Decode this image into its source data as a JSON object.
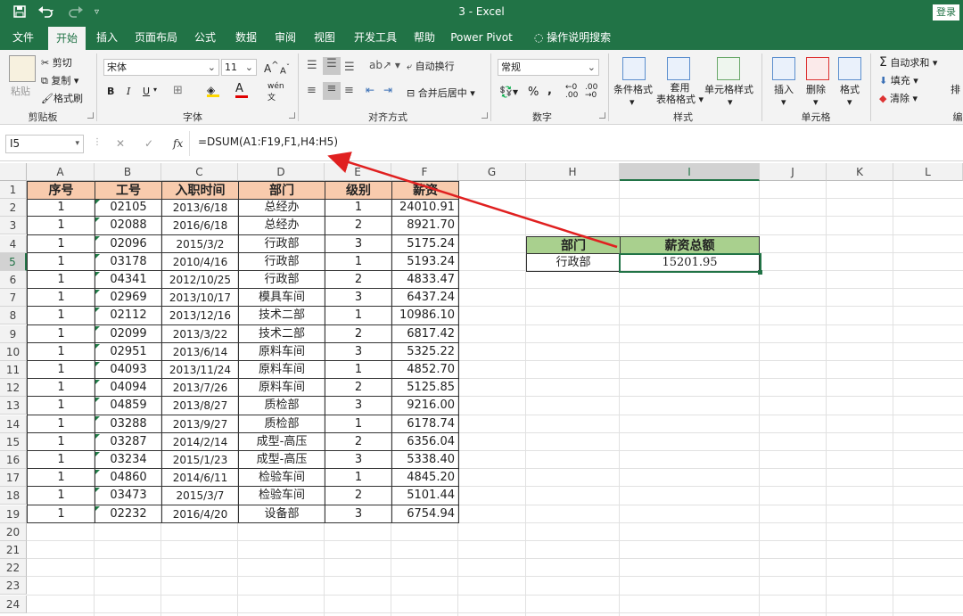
{
  "titlebar": {
    "title": "3  -  Excel",
    "save_icon": "save-icon",
    "undo_icon": "undo-icon",
    "redo_icon": "redo-icon",
    "customize_icon": "customize-qa-icon",
    "signin_label": "登录"
  },
  "tabs": [
    {
      "label": "文件"
    },
    {
      "label": "开始"
    },
    {
      "label": "插入"
    },
    {
      "label": "页面布局"
    },
    {
      "label": "公式"
    },
    {
      "label": "数据"
    },
    {
      "label": "审阅"
    },
    {
      "label": "视图"
    },
    {
      "label": "开发工具"
    },
    {
      "label": "帮助"
    },
    {
      "label": "Power Pivot"
    }
  ],
  "tell_me": "操作说明搜索",
  "ribbon": {
    "clipboard": {
      "paste": "粘贴",
      "cut": "剪切",
      "copy": "复制",
      "format_painter": "格式刷",
      "group": "剪贴板"
    },
    "font": {
      "name": "宋体",
      "size": "11",
      "grow": "A",
      "shrink": "A",
      "bold": "B",
      "italic": "I",
      "underline": "U",
      "font_color_letter": "A",
      "phonetic": "wén",
      "group": "字体"
    },
    "alignment": {
      "wrap": "自动换行",
      "merge": "合并后居中",
      "group": "对齐方式"
    },
    "number": {
      "format": "常规",
      "percent": "%",
      "comma": ",",
      "group": "数字"
    },
    "styles": {
      "conditional": "条件格式",
      "table_line1": "套用",
      "table_line2": "表格格式",
      "cell_styles": "单元格样式",
      "group": "样式"
    },
    "cells": {
      "insert": "插入",
      "delete": "删除",
      "format": "格式",
      "group": "单元格"
    },
    "editing": {
      "autosum": "自动求和",
      "fill": "填充",
      "clear": "清除",
      "sort": "排",
      "group": "编"
    }
  },
  "formula_bar": {
    "name_box": "I5",
    "cancel": "✕",
    "enter": "✓",
    "fx": "fx",
    "formula": "=DSUM(A1:F19,F1,H4:H5)"
  },
  "columns": [
    "A",
    "B",
    "C",
    "D",
    "E",
    "F",
    "G",
    "H",
    "I",
    "J",
    "K",
    "L"
  ],
  "rows": [
    "1",
    "2",
    "3",
    "4",
    "5",
    "6",
    "7",
    "8",
    "9",
    "10",
    "11",
    "12",
    "13",
    "14",
    "15",
    "16",
    "17",
    "18",
    "19",
    "20",
    "21",
    "22",
    "23",
    "24"
  ],
  "table": {
    "headers": [
      "序号",
      "工号",
      "入职时间",
      "部门",
      "级别",
      "薪资"
    ],
    "rows": [
      [
        "1",
        "02105",
        "2013/6/18",
        "总经办",
        "1",
        "24010.91"
      ],
      [
        "1",
        "02088",
        "2016/6/18",
        "总经办",
        "2",
        "8921.70"
      ],
      [
        "1",
        "02096",
        "2015/3/2",
        "行政部",
        "3",
        "5175.24"
      ],
      [
        "1",
        "03178",
        "2010/4/16",
        "行政部",
        "1",
        "5193.24"
      ],
      [
        "1",
        "04341",
        "2012/10/25",
        "行政部",
        "2",
        "4833.47"
      ],
      [
        "1",
        "02969",
        "2013/10/17",
        "模具车间",
        "3",
        "6437.24"
      ],
      [
        "1",
        "02112",
        "2013/12/16",
        "技术二部",
        "1",
        "10986.10"
      ],
      [
        "1",
        "02099",
        "2013/3/22",
        "技术二部",
        "2",
        "6817.42"
      ],
      [
        "1",
        "02951",
        "2013/6/14",
        "原料车间",
        "3",
        "5325.22"
      ],
      [
        "1",
        "04093",
        "2013/11/24",
        "原料车间",
        "1",
        "4852.70"
      ],
      [
        "1",
        "04094",
        "2013/7/26",
        "原料车间",
        "2",
        "5125.85"
      ],
      [
        "1",
        "04859",
        "2013/8/27",
        "质检部",
        "3",
        "9216.00"
      ],
      [
        "1",
        "03288",
        "2013/9/27",
        "质检部",
        "1",
        "6178.74"
      ],
      [
        "1",
        "03287",
        "2014/2/14",
        "成型-高压",
        "2",
        "6356.04"
      ],
      [
        "1",
        "03234",
        "2015/1/23",
        "成型-高压",
        "3",
        "5338.40"
      ],
      [
        "1",
        "04860",
        "2014/6/11",
        "检验车间",
        "1",
        "4845.20"
      ],
      [
        "1",
        "03473",
        "2015/3/7",
        "检验车间",
        "2",
        "5101.44"
      ],
      [
        "1",
        "02232",
        "2016/4/20",
        "设备部",
        "3",
        "6754.94"
      ]
    ]
  },
  "lookup": {
    "header_dept": "部门",
    "header_total": "薪资总额",
    "dept": "行政部",
    "total": "15201.95"
  },
  "colors": {
    "excel_green": "#217346",
    "header_fill": "#f8cbad",
    "lookup_fill": "#a9d08e",
    "arrow": "#e02020"
  }
}
